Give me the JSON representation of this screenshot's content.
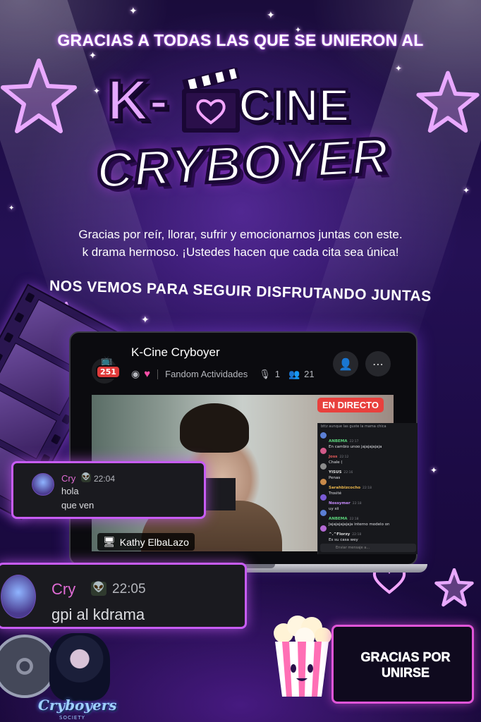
{
  "poster": {
    "headline": "GRACIAS A TODAS LAS QUE SE UNIERON AL",
    "logo_k": "K-",
    "logo_cine": "CINE",
    "logo_cryboyer": "CRYBOYER",
    "thanks_line1": "Gracias por reír, llorar, sufrir y emocionarnos juntas con este.",
    "thanks_line2": "k drama hermoso. ¡Ustedes hacen que cada cita sea única!",
    "subheadline": "NOS VEMOS PARA SEGUIR DISFRUTANDO JUNTAS",
    "ticket_text": "GRACIAS POR UNIRSE",
    "brand_text": "Cryboyers",
    "brand_sub": "SOCIETY"
  },
  "stage": {
    "server_badge": "251",
    "title": "K-Cine Cryboyer",
    "category": "Fandom Actividades",
    "speakers": "1",
    "listeners": "21",
    "live_label": "EN DIRECTO",
    "screen_share_name": "Kathy ElbaLazo"
  },
  "mini_chat": {
    "top_text": "bttz aunque las guste la mama chica",
    "messages": [
      {
        "name": "ANBEMA",
        "time": "22:17",
        "text": "En cambio unoo jajajajajaja",
        "color": "#5bd47b"
      },
      {
        "name": "Joss",
        "time": "22:12",
        "text": "Chale (",
        "color": "#e45b5b"
      },
      {
        "name": "YISUS",
        "time": "22:16",
        "text": "Penas",
        "color": "#e0e0e0"
      },
      {
        "name": "Sarahbizcocho",
        "time": "22:18",
        "text": "Trosité",
        "color": "#e8b44a"
      },
      {
        "name": "Nossymer",
        "time": "22:18",
        "text": "uy sii",
        "color": "#c98cff"
      },
      {
        "name": "ANBEMA",
        "time": "22:18",
        "text": "Jajajajajajaja interno modelo on",
        "color": "#5bd47b"
      },
      {
        "name": "^.^Florzy",
        "time": "22:18",
        "text": "Es su casa wey",
        "color": "#e0e0e0"
      }
    ],
    "input_placeholder": "Enviar mensaje a..."
  },
  "card_small": {
    "name": "Cry",
    "time": "22:04",
    "line1": "hola",
    "line2": "que ven"
  },
  "card_large": {
    "name": "Cry",
    "time": "22:05",
    "text": "gpi al kdrama"
  },
  "colors": {
    "accent_pink": "#c85cf6",
    "live_red": "#e8403d",
    "bg_deep": "#1c0b45",
    "username_pink": "#e06bd4"
  }
}
